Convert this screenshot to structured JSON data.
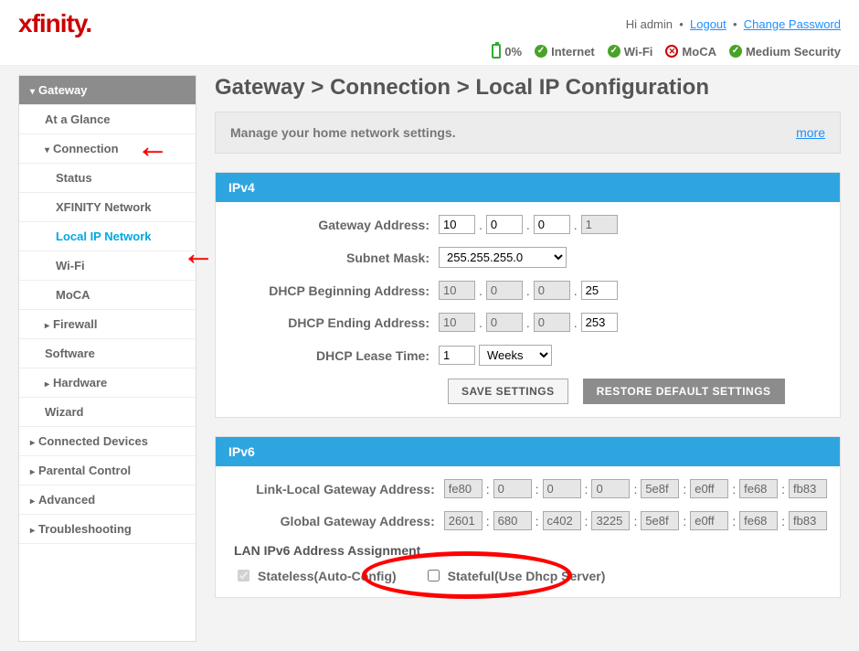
{
  "logo_text": "xfinity.",
  "header": {
    "greeting": "Hi admin",
    "logout": "Logout",
    "change_pw": "Change Password"
  },
  "status": {
    "battery": "0%",
    "internet": "Internet",
    "wifi": "Wi-Fi",
    "moca": "MoCA",
    "security": "Medium Security"
  },
  "sidebar": {
    "gateway": "Gateway",
    "glance": "At a Glance",
    "connection": "Connection",
    "status": "Status",
    "xnet": "XFINITY Network",
    "lipn": "Local IP Network",
    "wifi": "Wi-Fi",
    "moca": "MoCA",
    "firewall": "Firewall",
    "software": "Software",
    "hardware": "Hardware",
    "wizard": "Wizard",
    "connected": "Connected Devices",
    "parental": "Parental Control",
    "advanced": "Advanced",
    "trouble": "Troubleshooting"
  },
  "page": {
    "title": "Gateway > Connection > Local IP Configuration",
    "info": "Manage your home network settings.",
    "more": "more"
  },
  "ipv4": {
    "header": "IPv4",
    "labels": {
      "gateway": "Gateway Address:",
      "subnet": "Subnet Mask:",
      "begin": "DHCP Beginning Address:",
      "end": "DHCP Ending Address:",
      "lease": "DHCP Lease Time:"
    },
    "gateway": [
      "10",
      "0",
      "0",
      "1"
    ],
    "subnet": "255.255.255.0",
    "begin": [
      "10",
      "0",
      "0",
      "25"
    ],
    "end": [
      "10",
      "0",
      "0",
      "253"
    ],
    "lease_val": "1",
    "lease_unit": "Weeks",
    "save": "SAVE SETTINGS",
    "restore": "RESTORE DEFAULT SETTINGS"
  },
  "ipv6": {
    "header": "IPv6",
    "labels": {
      "link": "Link-Local Gateway Address:",
      "global": "Global Gateway Address:",
      "assign": "LAN IPv6 Address Assignment"
    },
    "link": [
      "fe80",
      "0",
      "0",
      "0",
      "5e8f",
      "e0ff",
      "fe68",
      "fb83"
    ],
    "global": [
      "2601",
      "680",
      "c402",
      "3225",
      "5e8f",
      "e0ff",
      "fe68",
      "fb83"
    ],
    "stateless": "Stateless(Auto-Config)",
    "stateful": "Stateful(Use Dhcp Server)"
  }
}
